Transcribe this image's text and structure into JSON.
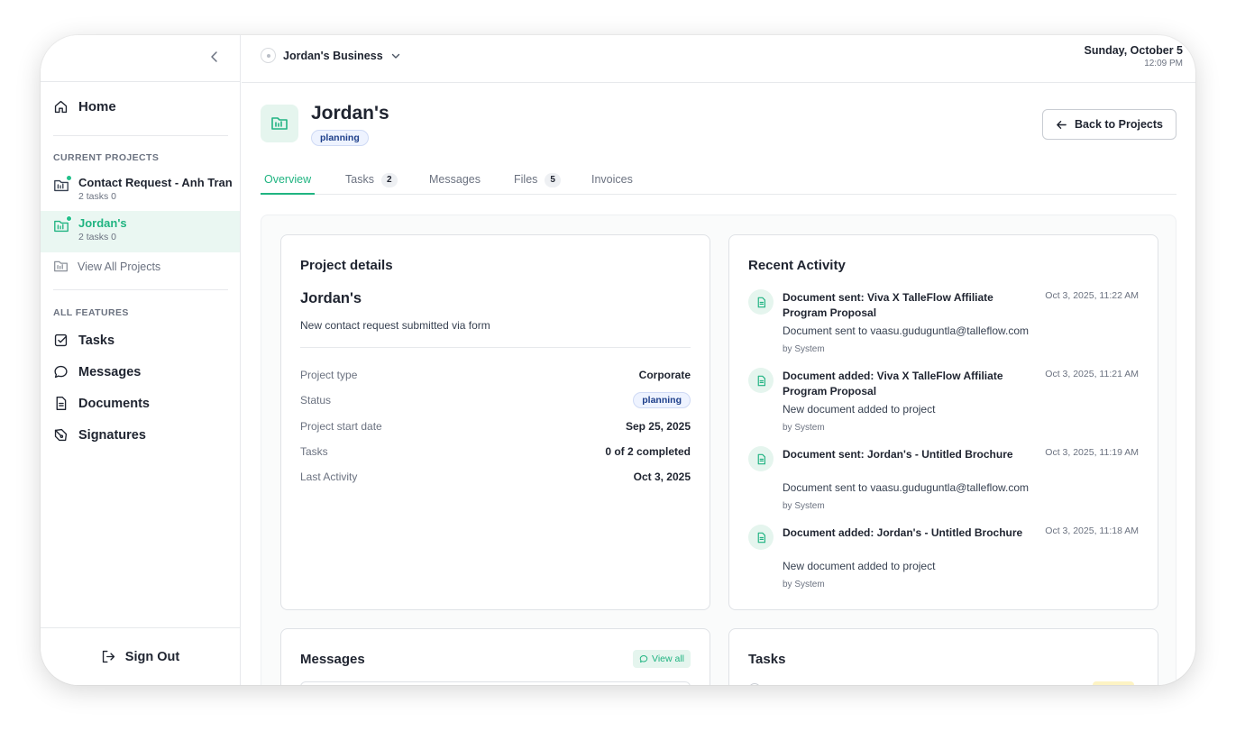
{
  "sidebar": {
    "home_label": "Home",
    "current_projects_heading": "CURRENT PROJECTS",
    "projects": [
      {
        "name": "Contact Request - Anh Tran",
        "meta": "2 tasks 0",
        "active": false
      },
      {
        "name": "Jordan's",
        "meta": "2 tasks 0",
        "active": true
      }
    ],
    "view_all_label": "View All Projects",
    "features_heading": "ALL FEATURES",
    "features": [
      {
        "label": "Tasks",
        "icon": "checkbox-icon"
      },
      {
        "label": "Messages",
        "icon": "chat-bubble-icon"
      },
      {
        "label": "Documents",
        "icon": "document-icon"
      },
      {
        "label": "Signatures",
        "icon": "signature-pen-icon"
      }
    ],
    "sign_out_label": "Sign Out"
  },
  "topbar": {
    "business_name": "Jordan's Business",
    "date": "Sunday, October 5",
    "time": "12:09 PM"
  },
  "project": {
    "title": "Jordan's",
    "status_badge": "planning",
    "back_label": "Back to Projects"
  },
  "tabs": [
    {
      "label": "Overview",
      "count": null,
      "active": true
    },
    {
      "label": "Tasks",
      "count": "2",
      "active": false
    },
    {
      "label": "Messages",
      "count": null,
      "active": false
    },
    {
      "label": "Files",
      "count": "5",
      "active": false
    },
    {
      "label": "Invoices",
      "count": null,
      "active": false
    }
  ],
  "details": {
    "heading": "Project details",
    "name": "Jordan's",
    "description": "New contact request submitted via form",
    "rows": {
      "type_label": "Project type",
      "type_value": "Corporate",
      "status_label": "Status",
      "status_value": "planning",
      "start_label": "Project start date",
      "start_value": "Sep 25, 2025",
      "tasks_label": "Tasks",
      "tasks_value": "0 of 2 completed",
      "activity_label": "Last Activity",
      "activity_value": "Oct 3, 2025"
    }
  },
  "activity": {
    "heading": "Recent Activity",
    "items": [
      {
        "title": "Document sent: Viva X TalleFlow Affiliate Program Proposal",
        "time": "Oct 3, 2025, 11:22 AM",
        "desc": "Document sent to vaasu.guduguntla@talleflow.com",
        "by": "by System"
      },
      {
        "title": "Document added: Viva X TalleFlow Affiliate Program Proposal",
        "time": "Oct 3, 2025, 11:21 AM",
        "desc": "New document added to project",
        "by": "by System"
      },
      {
        "title": "Document sent: Jordan's - Untitled Brochure",
        "time": "Oct 3, 2025, 11:19 AM",
        "desc": "Document sent to vaasu.guduguntla@talleflow.com",
        "by": "by System"
      },
      {
        "title": "Document added: Jordan's - Untitled Brochure",
        "time": "Oct 3, 2025, 11:18 AM",
        "desc": "New document added to project",
        "by": "by System"
      }
    ]
  },
  "messages_card": {
    "heading": "Messages",
    "view_all_label": "View all"
  },
  "tasks_card": {
    "heading": "Tasks"
  },
  "colors": {
    "accent": "#20b481",
    "badge_text": "#1d3f8a",
    "badge_bg": "#eef3ff"
  }
}
